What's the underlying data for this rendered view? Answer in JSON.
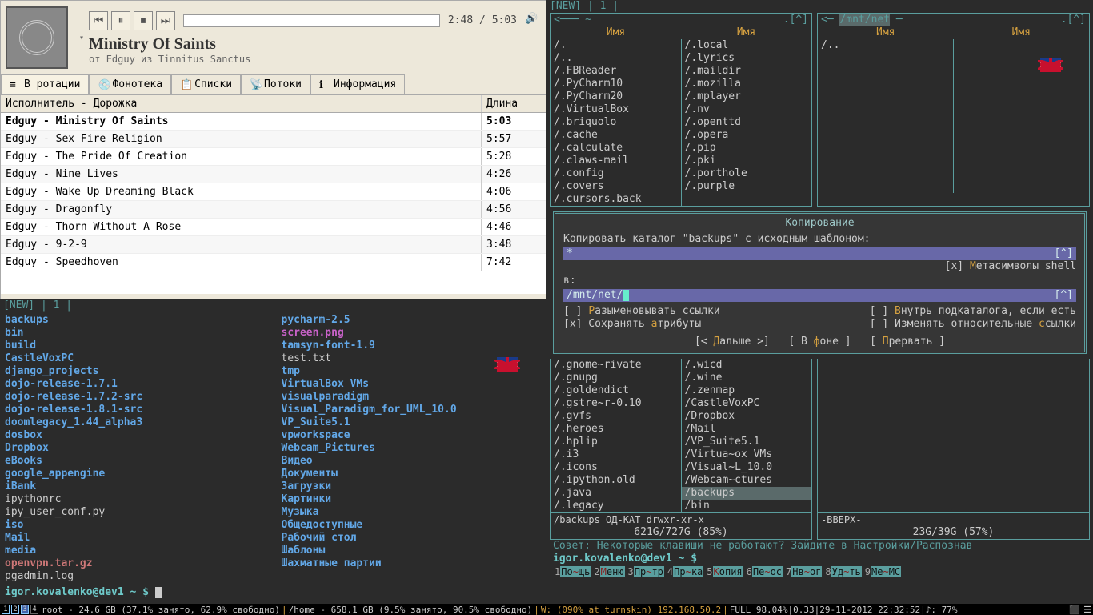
{
  "player": {
    "time": "2:48 / 5:03",
    "title": "Ministry Of Saints",
    "subtitle": "от Edguy из Tinnitus Sanctus",
    "tabs": [
      "В ротации",
      "Фонотека",
      "Списки",
      "Потоки",
      "Информация"
    ],
    "headers": {
      "artist": "Исполнитель - Дорожка",
      "len": "Длина"
    },
    "tracks": [
      {
        "t": "Edguy - Ministry Of Saints",
        "d": "5:03",
        "playing": true
      },
      {
        "t": "Edguy - Sex Fire Religion",
        "d": "5:57"
      },
      {
        "t": "Edguy - The Pride Of Creation",
        "d": "5:28"
      },
      {
        "t": "Edguy - Nine Lives",
        "d": "4:26"
      },
      {
        "t": "Edguy - Wake Up Dreaming Black",
        "d": "4:06"
      },
      {
        "t": "Edguy - Dragonfly",
        "d": "4:56"
      },
      {
        "t": "Edguy - Thorn Without A Rose",
        "d": "4:46"
      },
      {
        "t": "Edguy - 9-2-9",
        "d": "3:48"
      },
      {
        "t": "Edguy - Speedhoven",
        "d": "7:42"
      }
    ]
  },
  "term_left": {
    "tabs": "[NEW]  |  1  |",
    "ls": [
      {
        "n": "backups",
        "c": "dir"
      },
      {
        "n": "bin",
        "c": "dir"
      },
      {
        "n": "build",
        "c": "dir"
      },
      {
        "n": "CastleVoxPC",
        "c": "dir"
      },
      {
        "n": "django_projects",
        "c": "dir"
      },
      {
        "n": "dojo-release-1.7.1",
        "c": "dir"
      },
      {
        "n": "dojo-release-1.7.2-src",
        "c": "dir"
      },
      {
        "n": "dojo-release-1.8.1-src",
        "c": "dir"
      },
      {
        "n": "doomlegacy_1.44_alpha3",
        "c": "dir"
      },
      {
        "n": "dosbox",
        "c": "dir"
      },
      {
        "n": "Dropbox",
        "c": "dir"
      },
      {
        "n": "eBooks",
        "c": "dir"
      },
      {
        "n": "google_appengine",
        "c": "dir"
      },
      {
        "n": "iBank",
        "c": "dir"
      },
      {
        "n": "ipythonrc",
        "c": "file"
      },
      {
        "n": "ipy_user_conf.py",
        "c": "file"
      },
      {
        "n": "iso",
        "c": "dir"
      },
      {
        "n": "Mail",
        "c": "dir"
      },
      {
        "n": "media",
        "c": "dir"
      },
      {
        "n": "openvpn.tar.gz",
        "c": "arch"
      },
      {
        "n": "pgadmin.log",
        "c": "file"
      },
      {
        "n": "pycharm-2.5",
        "c": "dir"
      },
      {
        "n": "screen.png",
        "c": "img"
      },
      {
        "n": "tamsyn-font-1.9",
        "c": "dir"
      },
      {
        "n": "test.txt",
        "c": "file"
      },
      {
        "n": "tmp",
        "c": "dir"
      },
      {
        "n": "VirtualBox VMs",
        "c": "dir"
      },
      {
        "n": "visualparadigm",
        "c": "dir"
      },
      {
        "n": "Visual_Paradigm_for_UML_10.0",
        "c": "dir"
      },
      {
        "n": "VP_Suite5.1",
        "c": "dir"
      },
      {
        "n": "vpworkspace",
        "c": "dir"
      },
      {
        "n": "Webcam_Pictures",
        "c": "dir"
      },
      {
        "n": "Видео",
        "c": "dir"
      },
      {
        "n": "Документы",
        "c": "dir"
      },
      {
        "n": "Загрузки",
        "c": "dir"
      },
      {
        "n": "Картинки",
        "c": "dir"
      },
      {
        "n": "Музыка",
        "c": "dir"
      },
      {
        "n": "Общедоступные",
        "c": "dir"
      },
      {
        "n": "Рабочий стол",
        "c": "dir"
      },
      {
        "n": "Шаблоны",
        "c": "dir"
      },
      {
        "n": "Шахматные партии",
        "c": "dir"
      }
    ],
    "prompt_user": "igor.kovalenko@dev1",
    "prompt_path": "~",
    "prompt_sym": "$"
  },
  "mc": {
    "tabs": "[NEW]  |  1  |",
    "left_title": "<─── ~ ",
    "left_scroll": ".[^]",
    "right_title_a": "<─ ",
    "right_title_b": "/mnt/net",
    "right_scroll": ".[^]",
    "col_name": "Имя",
    "left_col1": [
      "/.",
      "/..",
      "/.FBReader",
      "/.PyCharm10",
      "/.PyCharm20",
      "/.VirtualBox",
      "/.briquolo",
      "/.cache",
      "/.calculate",
      "/.claws-mail",
      "/.config",
      "/.covers",
      "/.cursors.back"
    ],
    "left_col2": [
      "/.local",
      "/.lyrics",
      "/.maildir",
      "/.mozilla",
      "/.mplayer",
      "/.nv",
      "/.openttd",
      "/.opera",
      "/.pip",
      "/.pki",
      "/.porthole",
      "/.purple"
    ],
    "right_col1": [
      "/.."
    ],
    "left_col1b": [
      "/.gnome~rivate",
      "/.gnupg",
      "/.goldendict",
      "/.gstre~r-0.10",
      "/.gvfs",
      "/.heroes",
      "/.hplip",
      "/.i3",
      "/.icons",
      "/.ipython.old",
      "/.java",
      "/.legacy"
    ],
    "left_col2b": [
      "/.wicd",
      "/.wine",
      "/.zenmap",
      "/CastleVoxPC",
      "/Dropbox",
      "/Mail",
      "/VP_Suite5.1",
      "/Virtua~ox VMs",
      "/Visual~L_10.0",
      "/Webcam~ctures",
      "/backups",
      "/bin"
    ],
    "status_left": "/backups     ОД-КАТ drwxr-xr-x",
    "status_left_size": "621G/727G (85%)",
    "status_right": "-ВВЕРХ-",
    "status_right_size": "23G/39G (57%)",
    "hint": "Совет: Некоторые клавиши не работают? Зайдите в Настройки/Распознав",
    "prompt_user": "igor.kovalenko@dev1",
    "prompt_path": "~",
    "prompt_sym": "$",
    "fkeys": [
      {
        "n": "1",
        "pre": "По",
        "hl": "~",
        "post": "щь"
      },
      {
        "n": "2",
        "pre": "",
        "hl": "М",
        "post": "еню"
      },
      {
        "n": "3",
        "pre": "Пр",
        "hl": "~",
        "post": "тр"
      },
      {
        "n": "4",
        "pre": "Пр",
        "hl": "~",
        "post": "ка"
      },
      {
        "n": "5",
        "pre": "",
        "hl": "К",
        "post": "опия"
      },
      {
        "n": "6",
        "pre": "Пе",
        "hl": "~",
        "post": "ос"
      },
      {
        "n": "7",
        "pre": "Нв",
        "hl": "~",
        "post": "ог"
      },
      {
        "n": "8",
        "pre": "Уд",
        "hl": "~",
        "post": "ть"
      },
      {
        "n": "9",
        "pre": "Ме",
        "hl": "~",
        "post": "МС"
      }
    ]
  },
  "copy_dialog": {
    "title": "Копирование",
    "line1": "Копировать каталог \"backups\" с исходным шаблоном:",
    "pattern": "*",
    "suffix1": "[^]",
    "meta_label": "Метасимволы shell",
    "to_label": "в:",
    "to_value": "/mnt/net/",
    "suffix2": "[^]",
    "opt1": "Разыменовывать ссылки",
    "opt2": "Внутрь подкаталога, если есть",
    "opt3": "Сохранять атрибуты",
    "opt4": "Изменять относительные ссылки",
    "btn1": "[< Дальше >]",
    "btn2": "[ В фоне ]",
    "btn3": "[ Прервать ]"
  },
  "taskbar": {
    "ws": [
      "1",
      "2",
      "3",
      "4"
    ],
    "root": "root - 24.6 GB (37.1% занято, 62.9% свободно)",
    "home": "/home - 658.1 GB (9.5% занято, 90.5% свободно)",
    "wlan": "W: (090% at turnskin) 192.168.50.2",
    "full": "FULL 98.04%|0.33|29-11-2012 22:32:52|♪: 77%"
  }
}
